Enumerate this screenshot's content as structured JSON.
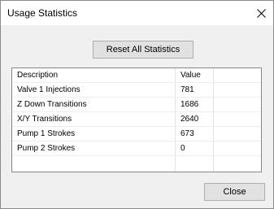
{
  "window": {
    "title": "Usage Statistics"
  },
  "reset_button": {
    "label": "Reset All Statistics"
  },
  "table": {
    "columns": [
      "Description",
      "Value"
    ],
    "rows": [
      {
        "description": "Valve 1 Injections",
        "value": "781"
      },
      {
        "description": "Z Down Transitions",
        "value": "1686"
      },
      {
        "description": "X/Y Transitions",
        "value": "2640"
      },
      {
        "description": "Pump 1 Strokes",
        "value": "673"
      },
      {
        "description": "Pump 2 Strokes",
        "value": "0"
      }
    ]
  },
  "close_button": {
    "label": "Close"
  }
}
